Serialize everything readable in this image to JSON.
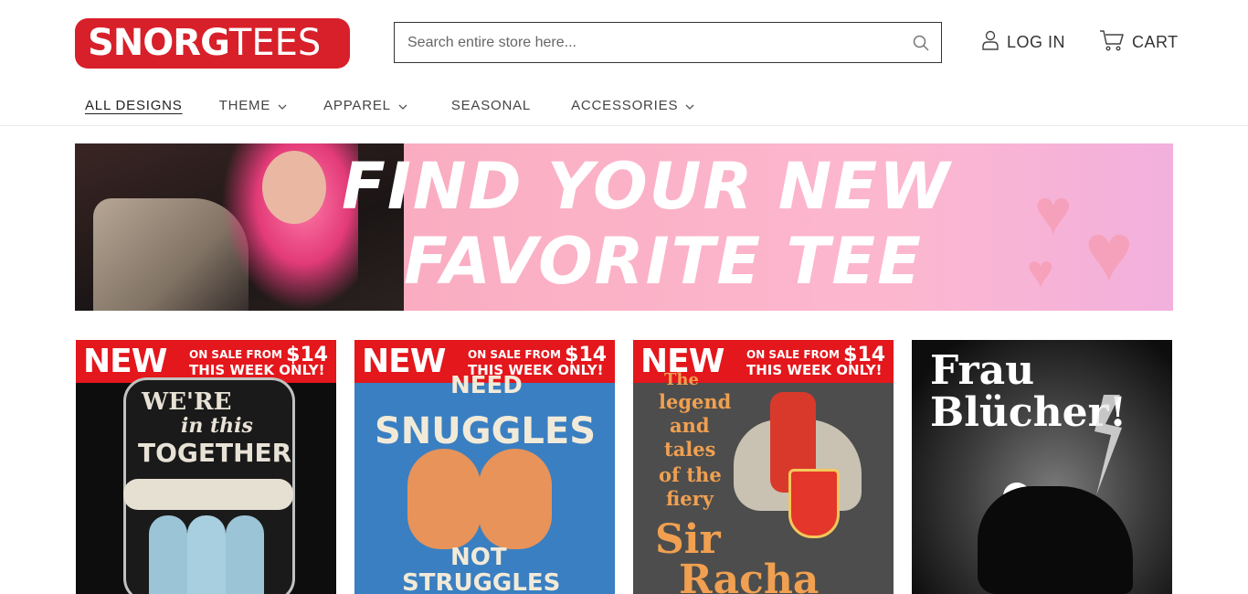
{
  "header": {
    "logo": {
      "bold": "SNORG",
      "light": "TEES"
    },
    "search": {
      "placeholder": "Search entire store here..."
    },
    "account": {
      "login_label": "LOG IN",
      "cart_label": "CART"
    }
  },
  "nav": {
    "items": [
      {
        "label": "ALL DESIGNS",
        "has_dropdown": false,
        "active": true
      },
      {
        "label": "THEME",
        "has_dropdown": true
      },
      {
        "label": "APPAREL",
        "has_dropdown": true
      },
      {
        "label": "SEASONAL",
        "has_dropdown": false
      },
      {
        "label": "ACCESSORIES",
        "has_dropdown": true
      }
    ]
  },
  "hero": {
    "line1": "FIND YOUR NEW",
    "line2": "FAVORITE TEE"
  },
  "products": [
    {
      "badge": {
        "new": "NEW",
        "line1": "ON SALE FROM",
        "amount": "$14",
        "line2": "THIS WEEK ONLY!"
      },
      "art": {
        "text1": "WE'RE",
        "text2": "in this",
        "text3": "TOGETHER"
      }
    },
    {
      "badge": {
        "new": "NEW",
        "line1": "ON SALE FROM",
        "amount": "$14",
        "line2": "THIS WEEK ONLY!"
      },
      "art": {
        "text1": "NEED",
        "text2": "SNUGGLES",
        "text3": "NOT",
        "text4": "STRUGGLES"
      }
    },
    {
      "badge": {
        "new": "NEW",
        "line1": "ON SALE FROM",
        "amount": "$14",
        "line2": "THIS WEEK ONLY!"
      },
      "art": {
        "text1": "The",
        "text2": "legend",
        "text3": "and",
        "text4": "tales",
        "text5": "of the",
        "text6": "fiery",
        "text7": "Sir",
        "text8": "Racha"
      }
    },
    {
      "art": {
        "text1": "Frau",
        "text2": "Blücher!"
      }
    }
  ],
  "colors": {
    "brand_red": "#d7202a",
    "sale_red": "#e3171c",
    "hero_pink": "#fbb1c6"
  }
}
